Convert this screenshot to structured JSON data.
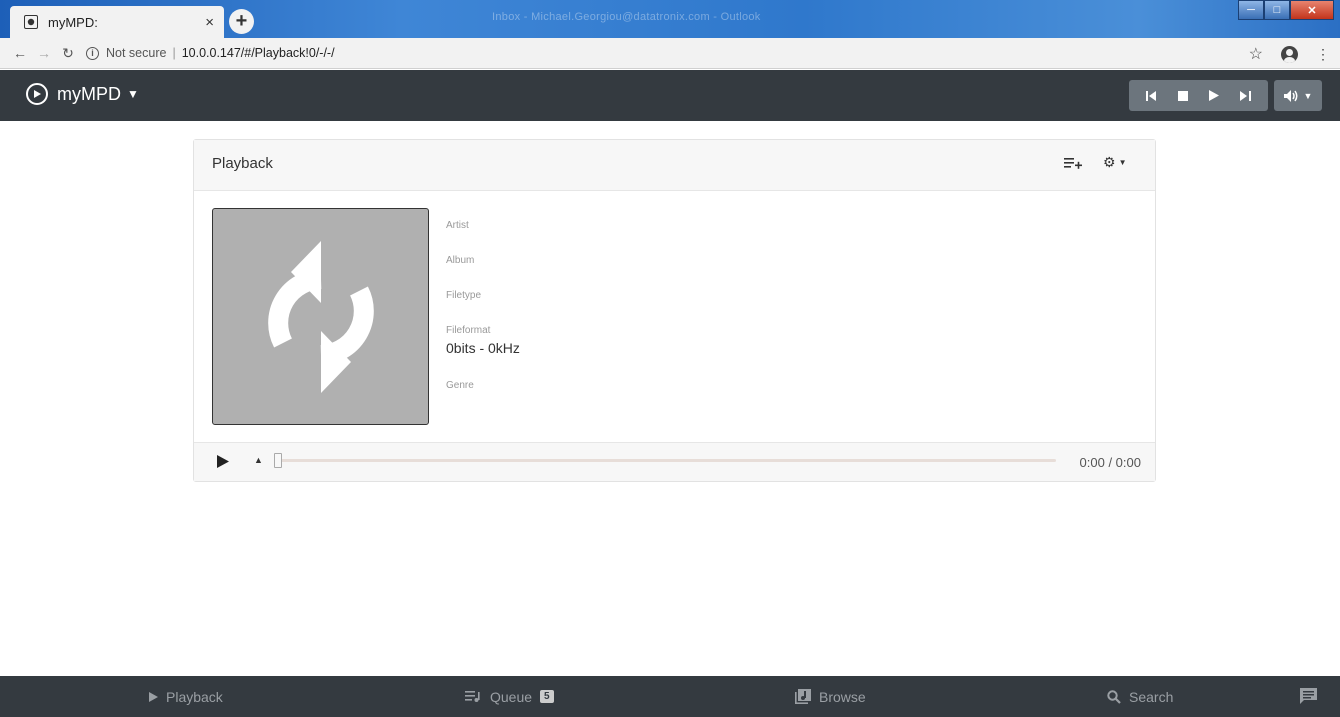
{
  "browser": {
    "tab_title": "myMPD:",
    "tab_close": "×",
    "new_tab": "+",
    "background_title": "Inbox - Michael.Georgiou@datatronix.com - Outlook",
    "not_secure": "Not secure",
    "separator": "|",
    "url": "10.0.0.147/#/Playback!0/-/-/"
  },
  "nav": {
    "brand": "myMPD"
  },
  "card": {
    "title": "Playback",
    "fields": {
      "artist_label": "Artist",
      "album_label": "Album",
      "filetype_label": "Filetype",
      "fileformat_label": "Fileformat",
      "fileformat_value": "0bits - 0kHz",
      "genre_label": "Genre"
    },
    "progress": {
      "elapsed_text": "0:00 / 0:00",
      "fraction": 0
    }
  },
  "bottom_nav": {
    "playback": "Playback",
    "queue": "Queue",
    "queue_count": "5",
    "browse": "Browse",
    "search": "Search"
  },
  "colors": {
    "navbar": "#343a40",
    "button": "#6c757d",
    "cover": "#b0b0b0"
  }
}
